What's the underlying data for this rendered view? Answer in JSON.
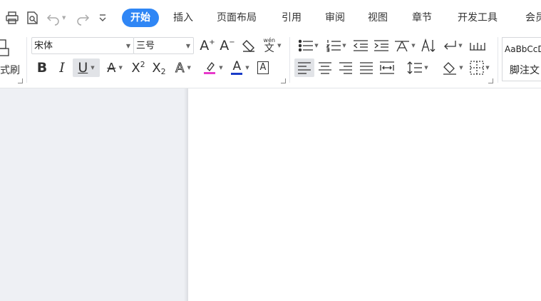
{
  "tabs": [
    {
      "label": "开始",
      "active": true
    },
    {
      "label": "插入"
    },
    {
      "label": "页面布局"
    },
    {
      "label": "引用"
    },
    {
      "label": "审阅"
    },
    {
      "label": "视图"
    },
    {
      "label": "章节"
    },
    {
      "label": "开发工具"
    },
    {
      "label": "会员"
    }
  ],
  "clipboard": {
    "format_painter_label": "式刷"
  },
  "font": {
    "name": "宋体",
    "size": "三号",
    "phonetic_glyph": "wén",
    "phonetic_char": "文",
    "superscript_letter": "X",
    "superscript_mark": "2",
    "subscript_letter": "X",
    "subscript_mark": "2",
    "effect_glyph": "A",
    "highlight_color": "#e83acb",
    "font_color": "#1a3cc8",
    "font_color_glyph": "A",
    "char_border_glyph": "A",
    "bold_glyph": "B",
    "italic_glyph": "I",
    "underline_glyph": "U",
    "strike_glyph": "A",
    "grow_glyph": "A",
    "shrink_glyph": "A"
  },
  "styles": {
    "preview_text": "AaBbCcDd",
    "footnote_label": "脚注文"
  },
  "colors": {
    "accent": "#2f86f5",
    "canvas": "#eef0f4",
    "page": "#ffffff"
  }
}
